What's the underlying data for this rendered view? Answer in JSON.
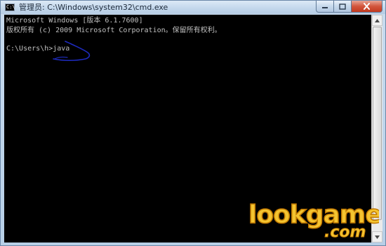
{
  "window": {
    "title": "管理员: C:\\Windows\\system32\\cmd.exe",
    "icon": "cmd-icon",
    "controls": {
      "minimize": "minimize-icon",
      "maximize": "maximize-icon",
      "close": "close-icon"
    }
  },
  "console": {
    "lines": [
      "Microsoft Windows [版本 6.1.7600]",
      "版权所有 (c) 2009 Microsoft Corporation。保留所有权利。",
      "",
      "C:\\Users\\h>java"
    ],
    "annotation": "blue-underline-scribble"
  },
  "watermark": {
    "text": "lookgame",
    "suffix": ".com",
    "colors": {
      "fill": "#f4c430",
      "outline": "#c07800",
      "dot": "#ffffff"
    }
  },
  "colors": {
    "console_bg": "#000000",
    "console_fg": "#c0c0c0",
    "titlebar": "#c4d8ec",
    "annotation": "#1e2bbf"
  }
}
